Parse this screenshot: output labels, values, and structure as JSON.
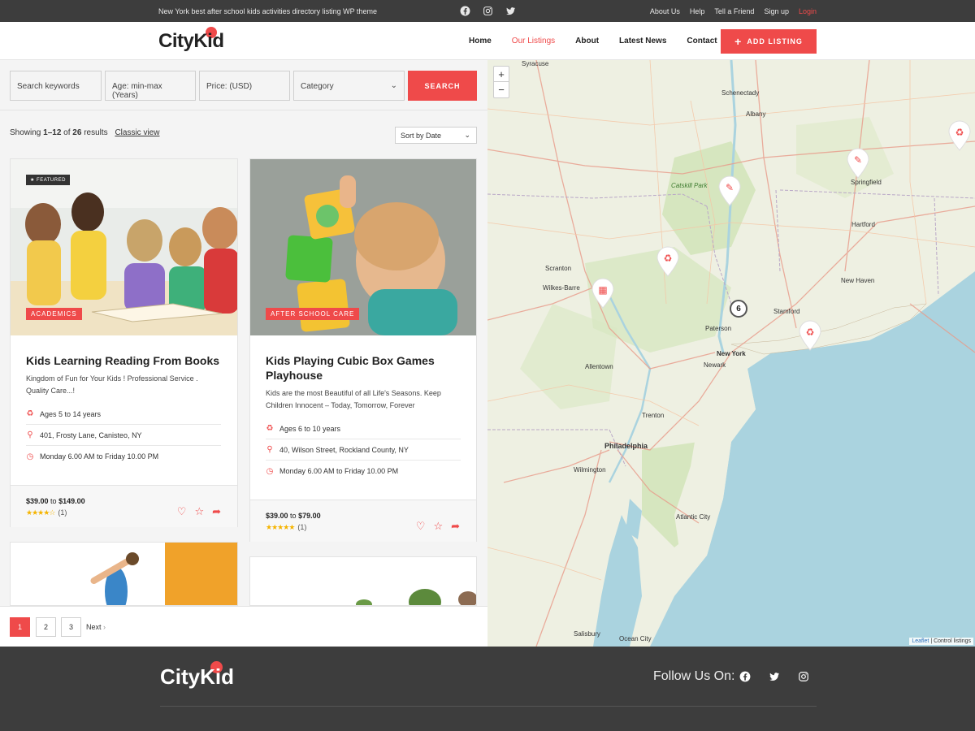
{
  "topbar": {
    "tagline": "New York best after school kids activities directory listing WP theme",
    "social_icons": [
      "facebook-icon",
      "instagram-icon",
      "twitter-icon"
    ],
    "links": [
      "About Us",
      "Help",
      "Tell a Friend",
      "Sign up"
    ],
    "login": "Login"
  },
  "header": {
    "logo": "CityKid",
    "nav": [
      "Home",
      "Our Listings",
      "About",
      "Latest News",
      "Contact"
    ],
    "active_nav": "Our Listings",
    "add_listing": "ADD LISTING"
  },
  "search": {
    "keywords_placeholder": "Search keywords",
    "age_placeholder": "Age: min-max (Years)",
    "price_placeholder": "Price: (USD)",
    "category": "Category",
    "button": "SEARCH"
  },
  "results": {
    "showing_prefix": "Showing ",
    "range": "1–12",
    "of": " of ",
    "total": "26",
    "suffix": " results",
    "classic_view": "Classic view",
    "sort": "Sort by Date"
  },
  "listings": [
    {
      "featured": "FEATURED",
      "category": "ACADEMICS",
      "title": "Kids Learning Reading From Books",
      "description": "Kingdom of Fun for Your Kids ! Professional Service . Quality Care...!",
      "ages": "Ages 5 to 14 years",
      "address": "401, Frosty Lane, Canisteo, NY",
      "hours": "Monday 6.00 AM to Friday 10.00 PM",
      "price_from": "$39.00",
      "price_to_word": "to",
      "price_to": "$149.00",
      "rating": 4,
      "rating_count": "(1)"
    },
    {
      "category": "AFTER SCHOOL CARE",
      "title": "Kids Playing Cubic Box Games Playhouse",
      "description": "Kids are the most Beautiful of all Life's Seasons. Keep Children Innocent – Today, Tomorrow, Forever",
      "ages": "Ages 6 to 10 years",
      "address": "40, Wilson Street, Rockland County, NY",
      "hours": "Monday 6.00 AM to Friday 10.00 PM",
      "price_from": "$39.00",
      "price_to_word": "to",
      "price_to": "$79.00",
      "rating": 5,
      "rating_count": "(1)"
    }
  ],
  "pagination": {
    "pages": [
      "1",
      "2",
      "3"
    ],
    "current": "1",
    "next": "Next"
  },
  "map": {
    "labels": [
      "Syracuse",
      "Schenectady",
      "Albany",
      "Catskill Park",
      "Springfield",
      "Hartford",
      "Scranton",
      "Wilkes-Barre",
      "New Haven",
      "Stamford",
      "Paterson",
      "New York",
      "Newark",
      "Allentown",
      "Trenton",
      "Philadelphia",
      "Wilmington",
      "Atlantic City",
      "Ocean City",
      "Salisbury"
    ],
    "cluster_count": "6",
    "attribution_leaflet": "Leaflet",
    "attribution_rest": " | Control listings",
    "zoom_in": "+",
    "zoom_out": "−"
  },
  "footer": {
    "logo": "CityKid",
    "follow": "Follow Us On:",
    "social_icons": [
      "facebook-icon",
      "twitter-icon",
      "instagram-icon"
    ]
  },
  "colors": {
    "accent": "#ef4a4a",
    "dark": "#3d3d3d",
    "star": "#f5b400"
  }
}
